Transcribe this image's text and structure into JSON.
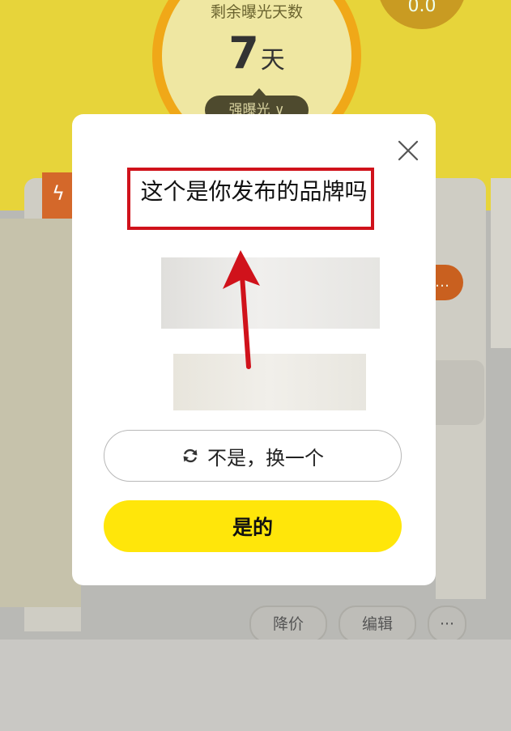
{
  "background": {
    "remain_label": "剩余曝光天数",
    "days_number": "7",
    "days_unit": "天",
    "boost_label": "强曝光 ∨",
    "corner_badge": "0.0",
    "price_cut_button": "降价",
    "edit_button": "编辑",
    "more_button": "···"
  },
  "dialog": {
    "question": "这个是你发布的品牌吗",
    "not_button_label": "不是，换一个",
    "yes_button_label": "是的",
    "close_icon": "close-icon",
    "refresh_icon": "refresh-icon"
  },
  "colors": {
    "accent_yellow": "#ffe60a",
    "highlight_red": "#d0121b",
    "background_yellow": "#e7d43a"
  }
}
